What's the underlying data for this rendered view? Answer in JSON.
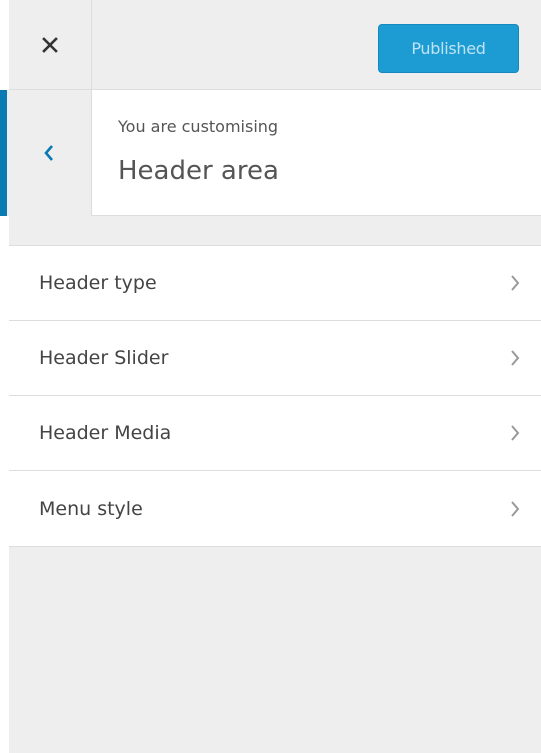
{
  "header": {
    "publish_label": "Published",
    "close_icon": "close-icon"
  },
  "section": {
    "customising_label": "You are customising",
    "title": "Header area",
    "back_icon": "chevron-left-icon"
  },
  "menu": {
    "items": [
      {
        "label": "Header type",
        "icon": "chevron-right-icon"
      },
      {
        "label": "Header Slider",
        "icon": "chevron-right-icon"
      },
      {
        "label": "Header Media",
        "icon": "chevron-right-icon"
      },
      {
        "label": "Menu style",
        "icon": "chevron-right-icon"
      }
    ]
  },
  "colors": {
    "accent": "#0a7ab3",
    "publish_bg": "#1d9cd3",
    "panel_bg": "#eeeeee"
  }
}
